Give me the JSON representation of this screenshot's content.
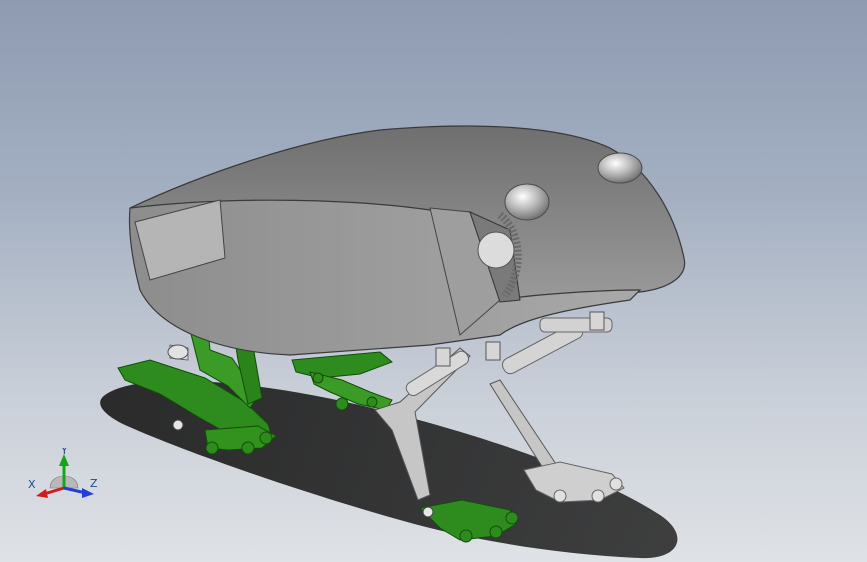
{
  "viewport": {
    "background_top": "#8e9bb1",
    "background_bottom": "#dfe2e6"
  },
  "model": {
    "shell_color": "#8a8a8a",
    "leg_green": "#2e8b1e",
    "leg_grey": "#b9b9b9",
    "shadow_color": "#1a1a1a"
  },
  "triad": {
    "x_label": "X",
    "y_label": "Y",
    "z_label": "Z",
    "x_color": "#d01c1c",
    "y_color": "#19a319",
    "z_color": "#1f3fd6"
  }
}
